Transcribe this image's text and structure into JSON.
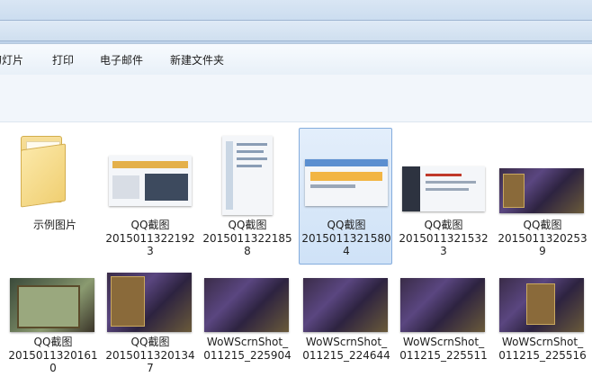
{
  "toolbar": {
    "items": [
      "幻灯片",
      "打印",
      "电子邮件",
      "新建文件夹"
    ]
  },
  "items": [
    {
      "name": "示例图片",
      "line2": "",
      "line3": ""
    },
    {
      "name": "QQ截图",
      "line2": "2015011322192",
      "line3": "3"
    },
    {
      "name": "QQ截图",
      "line2": "2015011322185",
      "line3": "8"
    },
    {
      "name": "QQ截图",
      "line2": "2015011321580",
      "line3": "4"
    },
    {
      "name": "QQ截图",
      "line2": "2015011321532",
      "line3": "3"
    },
    {
      "name": "QQ截图",
      "line2": "2015011320253",
      "line3": "9"
    },
    {
      "name": "QQ截图",
      "line2": "2015011320161",
      "line3": "0"
    },
    {
      "name": "QQ截图",
      "line2": "2015011320134",
      "line3": "7"
    },
    {
      "name": "WoWScrnShot_",
      "line2": "011215_225904",
      "line3": ""
    },
    {
      "name": "WoWScrnShot_",
      "line2": "011215_224644",
      "line3": ""
    },
    {
      "name": "WoWScrnShot_",
      "line2": "011215_225511",
      "line3": ""
    },
    {
      "name": "WoWScrnShot_",
      "line2": "011215_225516",
      "line3": ""
    }
  ],
  "selected_index": 3,
  "colors": {
    "selection_border": "#84acdd",
    "selection_fill": "#cfe2f7"
  }
}
